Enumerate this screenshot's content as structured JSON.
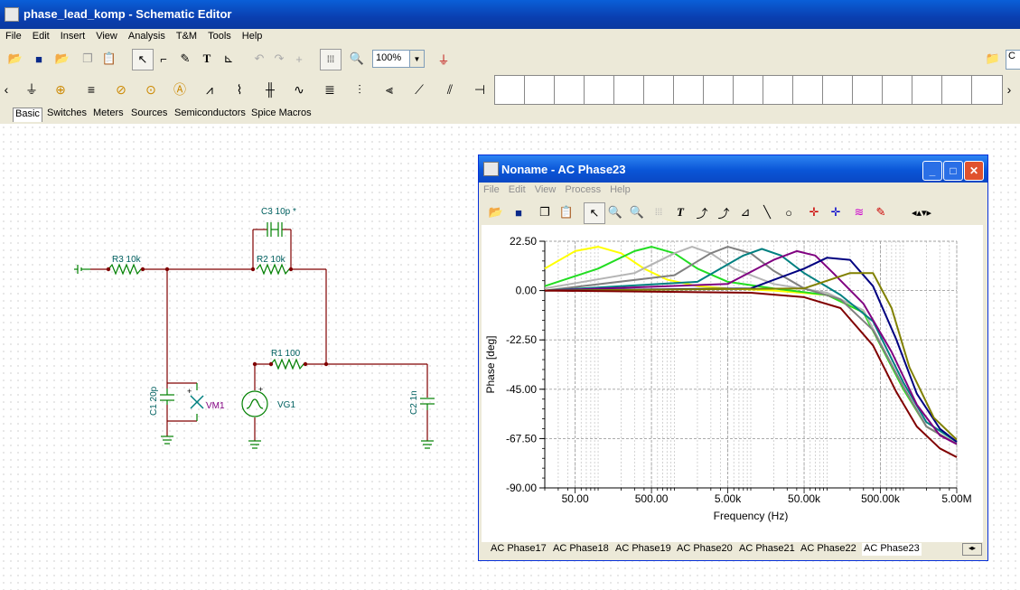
{
  "app": {
    "title": "phase_lead_komp - Schematic Editor"
  },
  "menu": [
    "File",
    "Edit",
    "Insert",
    "View",
    "Analysis",
    "T&M",
    "Tools",
    "Help"
  ],
  "toolbar": {
    "zoom": "100%",
    "right_partial": "C"
  },
  "component_tabs": [
    "Basic",
    "Switches",
    "Meters",
    "Sources",
    "Semiconductors",
    "Spice Macros"
  ],
  "schematic": {
    "labels": {
      "c3": "C3 10p *",
      "r3": "R3 10k",
      "r2": "R2 10k",
      "r1": "R1 100",
      "c1": "C1 20p",
      "vm1": "VM1",
      "vg1": "VG1",
      "c2": "C2 1n"
    }
  },
  "child_window": {
    "title": "Noname - AC Phase23",
    "menu": [
      "File",
      "Edit",
      "View",
      "Process",
      "Help"
    ],
    "tabs": [
      "AC Phase17",
      "AC Phase18",
      "AC Phase19",
      "AC Phase20",
      "AC Phase21",
      "AC Phase22",
      "AC Phase23"
    ]
  },
  "chart_data": {
    "type": "line",
    "title": "",
    "xlabel": "Frequency (Hz)",
    "ylabel": "Phase [deg]",
    "xscale": "log",
    "xlim": [
      20,
      5000000
    ],
    "ylim": [
      -90,
      22.5
    ],
    "xticks": [
      {
        "v": 50,
        "label": "50.00"
      },
      {
        "v": 500,
        "label": "500.00"
      },
      {
        "v": 5000,
        "label": "5.00k"
      },
      {
        "v": 50000,
        "label": "50.00k"
      },
      {
        "v": 500000,
        "label": "500.00k"
      },
      {
        "v": 5000000,
        "label": "5.00M"
      }
    ],
    "yticks": [
      {
        "v": 22.5,
        "label": "22.50"
      },
      {
        "v": 0,
        "label": "0.00"
      },
      {
        "v": -22.5,
        "label": "-22.50"
      },
      {
        "v": -45,
        "label": "-45.00"
      },
      {
        "v": -67.5,
        "label": "-67.50"
      },
      {
        "v": -90,
        "label": "-90.00"
      }
    ],
    "grid": true,
    "series": [
      {
        "color": "#ffff00",
        "x": [
          20,
          50,
          100,
          200,
          400,
          800,
          2000,
          5000,
          20000,
          100000,
          300000,
          1000000,
          2000000,
          5000000
        ],
        "y": [
          10,
          18,
          20,
          17,
          10,
          5,
          2,
          1,
          0,
          -2,
          -10,
          -45,
          -62,
          -70
        ]
      },
      {
        "color": "#22dd22",
        "x": [
          20,
          100,
          300,
          500,
          1000,
          2000,
          5000,
          20000,
          100000,
          300000,
          1000000,
          2000000,
          5000000
        ],
        "y": [
          2,
          10,
          18,
          20,
          17,
          10,
          4,
          1,
          -2,
          -10,
          -45,
          -62,
          -70
        ]
      },
      {
        "color": "#b4b4b4",
        "x": [
          20,
          300,
          1000,
          1700,
          3000,
          6000,
          20000,
          100000,
          300000,
          1000000,
          2000000,
          5000000
        ],
        "y": [
          1,
          8,
          17,
          20,
          17,
          10,
          3,
          -1,
          -9,
          -44,
          -62,
          -70
        ]
      },
      {
        "color": "#808080",
        "x": [
          20,
          1000,
          3000,
          5000,
          10000,
          20000,
          50000,
          150000,
          400000,
          1000000,
          2000000,
          5000000
        ],
        "y": [
          0,
          7,
          17,
          20,
          17,
          9,
          1,
          -4,
          -18,
          -44,
          -62,
          -70
        ]
      },
      {
        "color": "#008080",
        "x": [
          20,
          2000,
          8000,
          14000,
          25000,
          50000,
          150000,
          400000,
          1000000,
          2000000,
          5000000
        ],
        "y": [
          0,
          4,
          16,
          19,
          16,
          8,
          -2,
          -14,
          -42,
          -60,
          -69
        ]
      },
      {
        "color": "#800080",
        "x": [
          20,
          5000,
          20000,
          40000,
          70000,
          120000,
          300000,
          700000,
          1500000,
          3000000,
          5000000
        ],
        "y": [
          0,
          3,
          14,
          18,
          16,
          8,
          -6,
          -28,
          -52,
          -66,
          -70
        ]
      },
      {
        "color": "#000080",
        "x": [
          20,
          10000,
          50000,
          100000,
          200000,
          400000,
          800000,
          1500000,
          3000000,
          5000000
        ],
        "y": [
          0,
          1,
          10,
          15,
          14,
          2,
          -22,
          -47,
          -63,
          -69
        ]
      },
      {
        "color": "#808000",
        "x": [
          20,
          50000,
          200000,
          400000,
          700000,
          1200000,
          2500000,
          5000000
        ],
        "y": [
          0,
          1,
          8,
          8,
          -8,
          -35,
          -58,
          -68
        ]
      },
      {
        "color": "#800000",
        "x": [
          20,
          10000,
          50000,
          150000,
          400000,
          800000,
          1500000,
          3000000,
          5000000
        ],
        "y": [
          0,
          -1,
          -3,
          -8,
          -25,
          -46,
          -62,
          -72,
          -76
        ]
      }
    ]
  }
}
